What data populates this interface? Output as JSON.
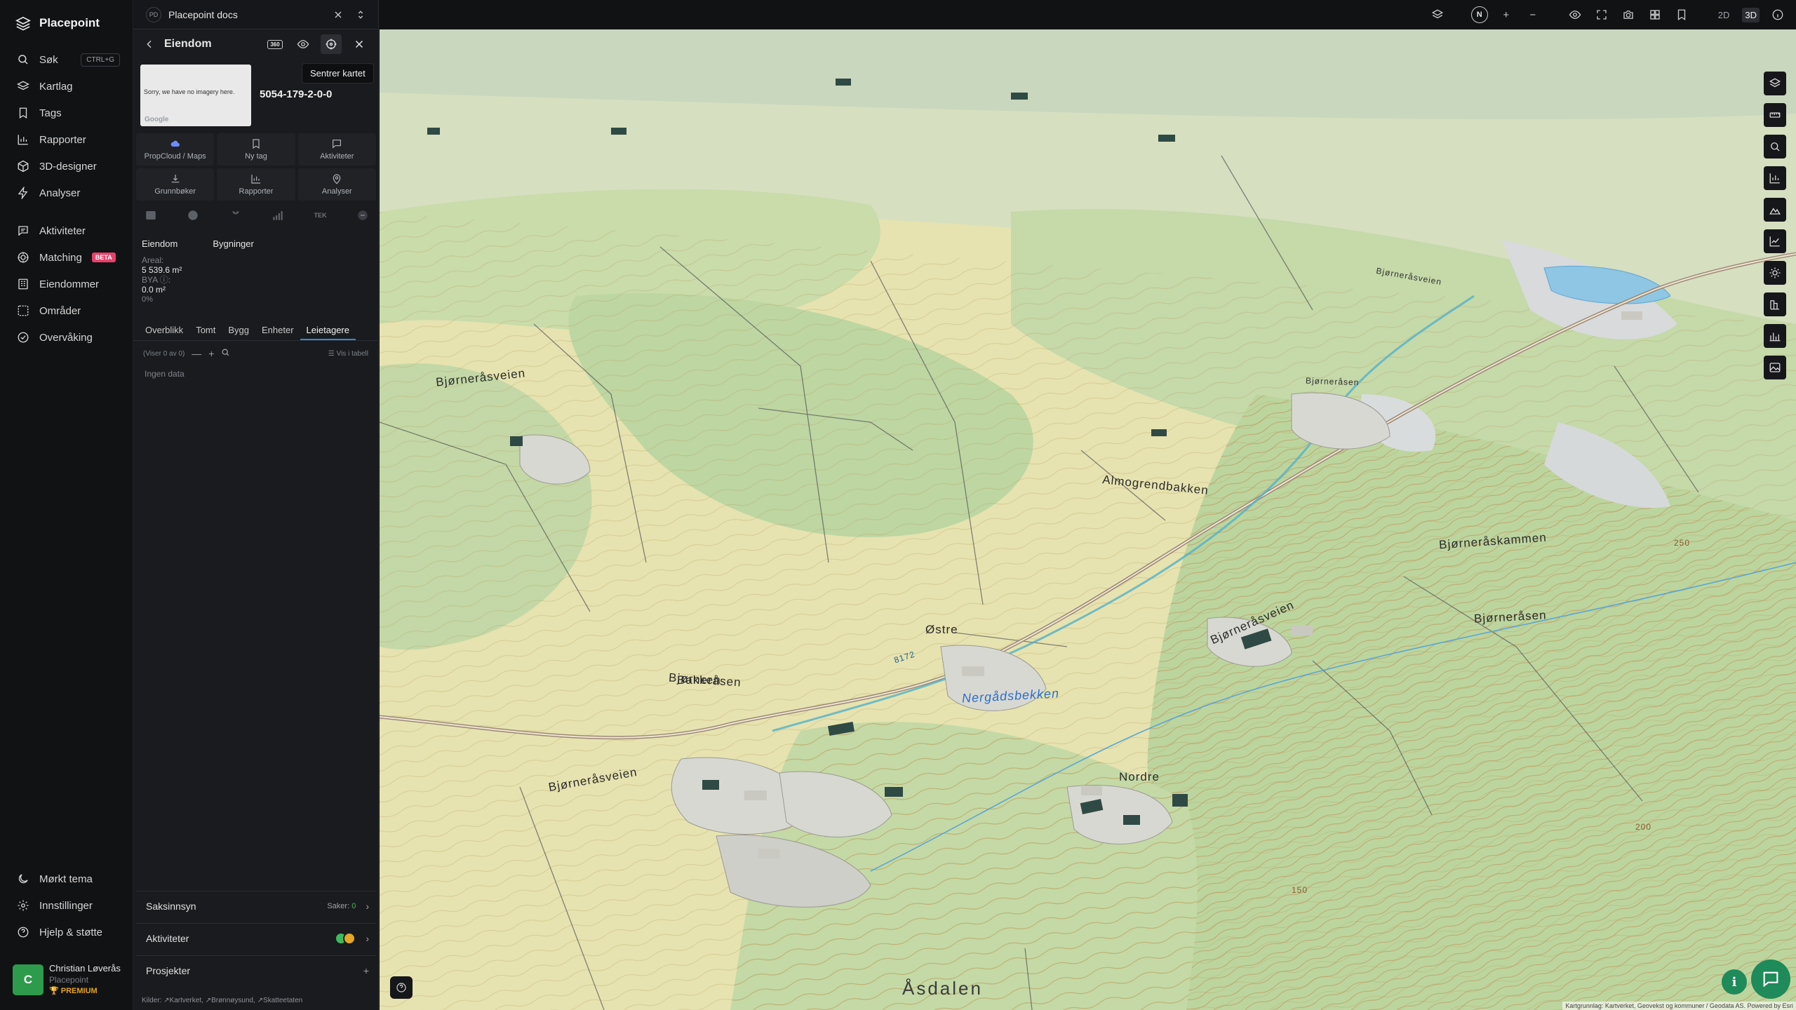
{
  "app": {
    "name": "Placepoint"
  },
  "nav": {
    "search": {
      "label": "Søk",
      "shortcut": "CTRL+G"
    },
    "items": [
      {
        "id": "kartlag",
        "label": "Kartlag"
      },
      {
        "id": "tags",
        "label": "Tags"
      },
      {
        "id": "rapporter",
        "label": "Rapporter"
      },
      {
        "id": "3d-designer",
        "label": "3D-designer"
      },
      {
        "id": "analyser",
        "label": "Analyser"
      }
    ],
    "items2": [
      {
        "id": "aktiviteter",
        "label": "Aktiviteter"
      },
      {
        "id": "matching",
        "label": "Matching",
        "badge": "BETA"
      },
      {
        "id": "eiendommer",
        "label": "Eiendommer"
      },
      {
        "id": "omrader",
        "label": "Områder"
      },
      {
        "id": "overvaking",
        "label": "Overvåking"
      }
    ],
    "bottom": [
      {
        "id": "dark-theme",
        "label": "Mørkt tema"
      },
      {
        "id": "settings",
        "label": "Innstillinger"
      },
      {
        "id": "help",
        "label": "Hjelp & støtte"
      }
    ],
    "user": {
      "initial": "C",
      "name": "Christian Løverås",
      "org": "Placepoint",
      "tier": "PREMIUM"
    }
  },
  "doc": {
    "badge": "PD",
    "title": "Placepoint docs"
  },
  "panel": {
    "title": "Eiendom",
    "tag360": "360",
    "tooltip": "Sentrer kartet",
    "imagery_msg": "Sorry, we have no imagery here.",
    "imagery_brand": "Google",
    "parcel_id": "5054-179-2-0-0",
    "quick": [
      {
        "id": "propcloud",
        "label": "PropCloud / Maps",
        "icon": "cloud-icon"
      },
      {
        "id": "ny-tag",
        "label": "Ny tag",
        "icon": "bookmark-icon"
      },
      {
        "id": "aktiviteter",
        "label": "Aktiviteter",
        "icon": "chat-icon"
      },
      {
        "id": "grunnboker",
        "label": "Grunnbøker",
        "icon": "download-icon"
      },
      {
        "id": "rapporter",
        "label": "Rapporter",
        "icon": "chart-icon"
      },
      {
        "id": "analyser",
        "label": "Analyser",
        "icon": "pin-icon"
      }
    ],
    "tools_tek": "TEK",
    "sub_tabs": [
      "Eiendom",
      "Bygninger"
    ],
    "info": {
      "areal_label": "Areal:",
      "areal_value": "5 539.6",
      "areal_unit": "m²",
      "bya_label": "BYA ⓘ:",
      "bya_value": "0.0",
      "bya_unit": "m²",
      "bya_pct": "0%"
    },
    "tabs": [
      "Overblikk",
      "Tomt",
      "Bygg",
      "Enheter",
      "Leietagere"
    ],
    "active_tab": "Leietagere",
    "list": {
      "showing": "(Viser 0 av 0)",
      "table_label": "Vis i tabell",
      "empty": "Ingen data"
    },
    "sections": {
      "saksinnsyn": {
        "label": "Saksinnsyn",
        "count_label": "Saker:",
        "count": "0"
      },
      "aktiviteter": {
        "label": "Aktiviteter"
      },
      "prosjekter": {
        "label": "Prosjekter"
      }
    },
    "sources": {
      "label": "Kilder:",
      "items": [
        "Kartverket,",
        "Brønnøysund,",
        "Skatteetaten"
      ]
    }
  },
  "map": {
    "mode_2d": "2D",
    "mode_3d": "3D",
    "compass": "N",
    "labels": {
      "bjorneraasveien_top": "Bjørneråsveien",
      "bjorneraasveien_bottom": "Bjørneråsveien",
      "bjorneraasveien_road": "Bjørneråsveien",
      "bjorneraasen_top": "Bjørneråsen",
      "bjorneraasen_mid": "Bjørneråsen",
      "bjorneraasen_right": "Bjørneråsen",
      "bjorneraaskammen": "Bjørneråskammen",
      "almogrendbakken": "Almogrendbakken",
      "nergardsbekken": "Nergådsbekken",
      "bakken": "Bakken",
      "ostre": "Østre",
      "nordre": "Nordre",
      "asdalen": "Åsdalen",
      "road_no": "8172",
      "contour_200": "200",
      "contour_250": "250",
      "contour_150": "150"
    },
    "attribution": "Kartgrunnlag: Kartverket, Geovekst og kommuner / Geodata AS. Powered by Esri"
  }
}
